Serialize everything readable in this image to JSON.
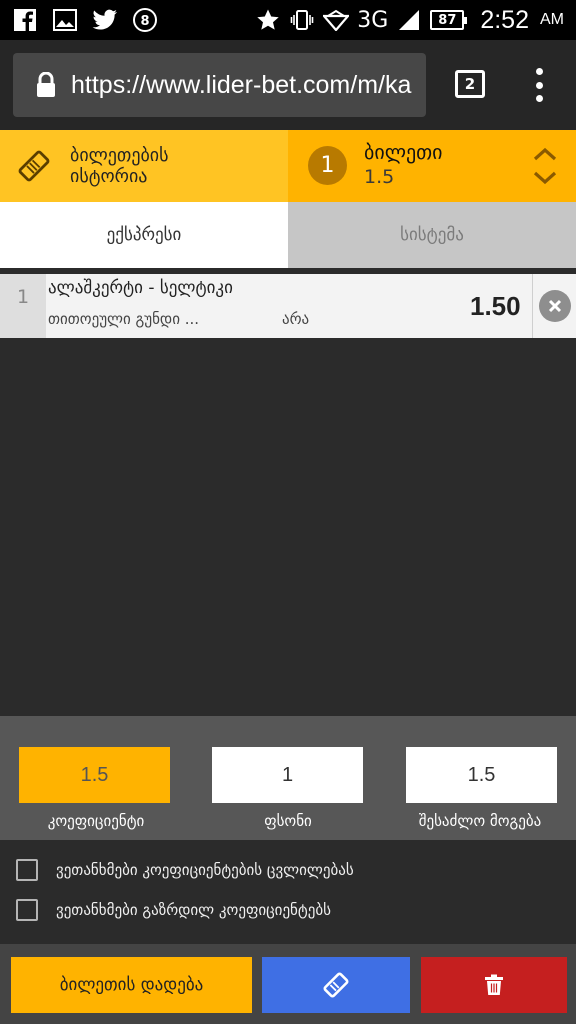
{
  "status_bar": {
    "network": "3G",
    "battery": "87",
    "time": "2:52",
    "ampm": "AM",
    "icons": [
      "facebook-icon",
      "image-icon",
      "twitter-icon",
      "badge-8-icon",
      "star-icon",
      "vibrate-icon",
      "wifi-icon",
      "signal-icon",
      "battery-icon"
    ]
  },
  "browser": {
    "url": "https://www.lider-bet.com/m/ka",
    "tab_count": "2"
  },
  "ticket_header": {
    "history_label": "ბილეთების\nისტორია",
    "ticket_count": "1",
    "ticket_title": "ბილეთი",
    "ticket_odds": "1.5"
  },
  "type_tabs": {
    "express": "ექსპრესი",
    "system": "სისტემა"
  },
  "bets": [
    {
      "index": "1",
      "match": "ალაშკერტი - სელტიკი",
      "market": "თითოეული გუნდი ...",
      "pick": "არა",
      "odds": "1.50"
    }
  ],
  "summary": {
    "coef_value": "1.5",
    "stake_value": "1",
    "win_value": "1.5",
    "coef_label": "კოეფიციენტი",
    "stake_label": "ფსონი",
    "win_label": "შესაძლო მოგება"
  },
  "agreements": {
    "odds_change": "ვეთანხმები კოეფიციენტების ცვლილებას",
    "odds_increase": "ვეთანხმები გაზრდილ კოეფიციენტებს"
  },
  "actions": {
    "place_bet": "ბილეთის დადება"
  },
  "colors": {
    "accent": "#ffb300",
    "accent_light": "#ffc423",
    "share": "#3f6fe4",
    "delete": "#c51f1f"
  }
}
